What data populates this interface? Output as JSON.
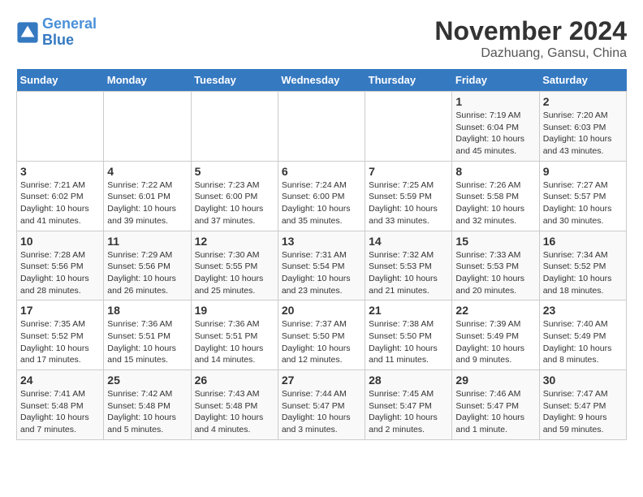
{
  "logo": {
    "line1": "General",
    "line2": "Blue"
  },
  "title": "November 2024",
  "location": "Dazhuang, Gansu, China",
  "weekdays": [
    "Sunday",
    "Monday",
    "Tuesday",
    "Wednesday",
    "Thursday",
    "Friday",
    "Saturday"
  ],
  "weeks": [
    [
      {
        "day": "",
        "info": ""
      },
      {
        "day": "",
        "info": ""
      },
      {
        "day": "",
        "info": ""
      },
      {
        "day": "",
        "info": ""
      },
      {
        "day": "",
        "info": ""
      },
      {
        "day": "1",
        "info": "Sunrise: 7:19 AM\nSunset: 6:04 PM\nDaylight: 10 hours and 45 minutes."
      },
      {
        "day": "2",
        "info": "Sunrise: 7:20 AM\nSunset: 6:03 PM\nDaylight: 10 hours and 43 minutes."
      }
    ],
    [
      {
        "day": "3",
        "info": "Sunrise: 7:21 AM\nSunset: 6:02 PM\nDaylight: 10 hours and 41 minutes."
      },
      {
        "day": "4",
        "info": "Sunrise: 7:22 AM\nSunset: 6:01 PM\nDaylight: 10 hours and 39 minutes."
      },
      {
        "day": "5",
        "info": "Sunrise: 7:23 AM\nSunset: 6:00 PM\nDaylight: 10 hours and 37 minutes."
      },
      {
        "day": "6",
        "info": "Sunrise: 7:24 AM\nSunset: 6:00 PM\nDaylight: 10 hours and 35 minutes."
      },
      {
        "day": "7",
        "info": "Sunrise: 7:25 AM\nSunset: 5:59 PM\nDaylight: 10 hours and 33 minutes."
      },
      {
        "day": "8",
        "info": "Sunrise: 7:26 AM\nSunset: 5:58 PM\nDaylight: 10 hours and 32 minutes."
      },
      {
        "day": "9",
        "info": "Sunrise: 7:27 AM\nSunset: 5:57 PM\nDaylight: 10 hours and 30 minutes."
      }
    ],
    [
      {
        "day": "10",
        "info": "Sunrise: 7:28 AM\nSunset: 5:56 PM\nDaylight: 10 hours and 28 minutes."
      },
      {
        "day": "11",
        "info": "Sunrise: 7:29 AM\nSunset: 5:56 PM\nDaylight: 10 hours and 26 minutes."
      },
      {
        "day": "12",
        "info": "Sunrise: 7:30 AM\nSunset: 5:55 PM\nDaylight: 10 hours and 25 minutes."
      },
      {
        "day": "13",
        "info": "Sunrise: 7:31 AM\nSunset: 5:54 PM\nDaylight: 10 hours and 23 minutes."
      },
      {
        "day": "14",
        "info": "Sunrise: 7:32 AM\nSunset: 5:53 PM\nDaylight: 10 hours and 21 minutes."
      },
      {
        "day": "15",
        "info": "Sunrise: 7:33 AM\nSunset: 5:53 PM\nDaylight: 10 hours and 20 minutes."
      },
      {
        "day": "16",
        "info": "Sunrise: 7:34 AM\nSunset: 5:52 PM\nDaylight: 10 hours and 18 minutes."
      }
    ],
    [
      {
        "day": "17",
        "info": "Sunrise: 7:35 AM\nSunset: 5:52 PM\nDaylight: 10 hours and 17 minutes."
      },
      {
        "day": "18",
        "info": "Sunrise: 7:36 AM\nSunset: 5:51 PM\nDaylight: 10 hours and 15 minutes."
      },
      {
        "day": "19",
        "info": "Sunrise: 7:36 AM\nSunset: 5:51 PM\nDaylight: 10 hours and 14 minutes."
      },
      {
        "day": "20",
        "info": "Sunrise: 7:37 AM\nSunset: 5:50 PM\nDaylight: 10 hours and 12 minutes."
      },
      {
        "day": "21",
        "info": "Sunrise: 7:38 AM\nSunset: 5:50 PM\nDaylight: 10 hours and 11 minutes."
      },
      {
        "day": "22",
        "info": "Sunrise: 7:39 AM\nSunset: 5:49 PM\nDaylight: 10 hours and 9 minutes."
      },
      {
        "day": "23",
        "info": "Sunrise: 7:40 AM\nSunset: 5:49 PM\nDaylight: 10 hours and 8 minutes."
      }
    ],
    [
      {
        "day": "24",
        "info": "Sunrise: 7:41 AM\nSunset: 5:48 PM\nDaylight: 10 hours and 7 minutes."
      },
      {
        "day": "25",
        "info": "Sunrise: 7:42 AM\nSunset: 5:48 PM\nDaylight: 10 hours and 5 minutes."
      },
      {
        "day": "26",
        "info": "Sunrise: 7:43 AM\nSunset: 5:48 PM\nDaylight: 10 hours and 4 minutes."
      },
      {
        "day": "27",
        "info": "Sunrise: 7:44 AM\nSunset: 5:47 PM\nDaylight: 10 hours and 3 minutes."
      },
      {
        "day": "28",
        "info": "Sunrise: 7:45 AM\nSunset: 5:47 PM\nDaylight: 10 hours and 2 minutes."
      },
      {
        "day": "29",
        "info": "Sunrise: 7:46 AM\nSunset: 5:47 PM\nDaylight: 10 hours and 1 minute."
      },
      {
        "day": "30",
        "info": "Sunrise: 7:47 AM\nSunset: 5:47 PM\nDaylight: 9 hours and 59 minutes."
      }
    ]
  ]
}
